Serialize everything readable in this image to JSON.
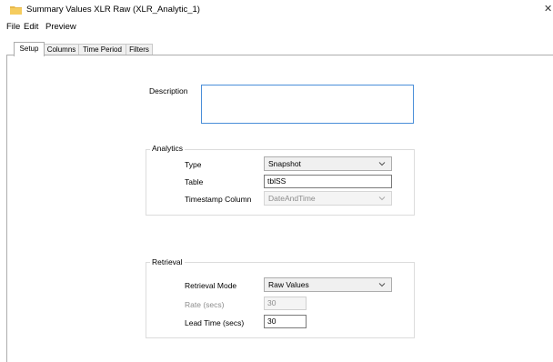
{
  "window": {
    "title": "Summary Values XLR Raw (XLR_Analytic_1)",
    "close_glyph": "✕",
    "icon": "folder-icon",
    "icon_color": "#e8b84a"
  },
  "menu": [
    "File",
    "Edit",
    "Preview"
  ],
  "tabs": [
    "Setup",
    "Columns",
    "Time Period",
    "Filters"
  ],
  "active_tab": "Setup",
  "setup": {
    "description_label": "Description",
    "description_value": "",
    "analytics": {
      "legend": "Analytics",
      "type_label": "Type",
      "type_value": "Snapshot",
      "table_label": "Table",
      "table_value": "tblSS",
      "timestamp_label": "Timestamp Column",
      "timestamp_value": "DateAndTime"
    },
    "retrieval": {
      "legend": "Retrieval",
      "mode_label": "Retrieval Mode",
      "mode_value": "Raw Values",
      "rate_label": "Rate (secs)",
      "rate_value": "30",
      "lead_label": "Lead Time (secs)",
      "lead_value": "30"
    }
  }
}
